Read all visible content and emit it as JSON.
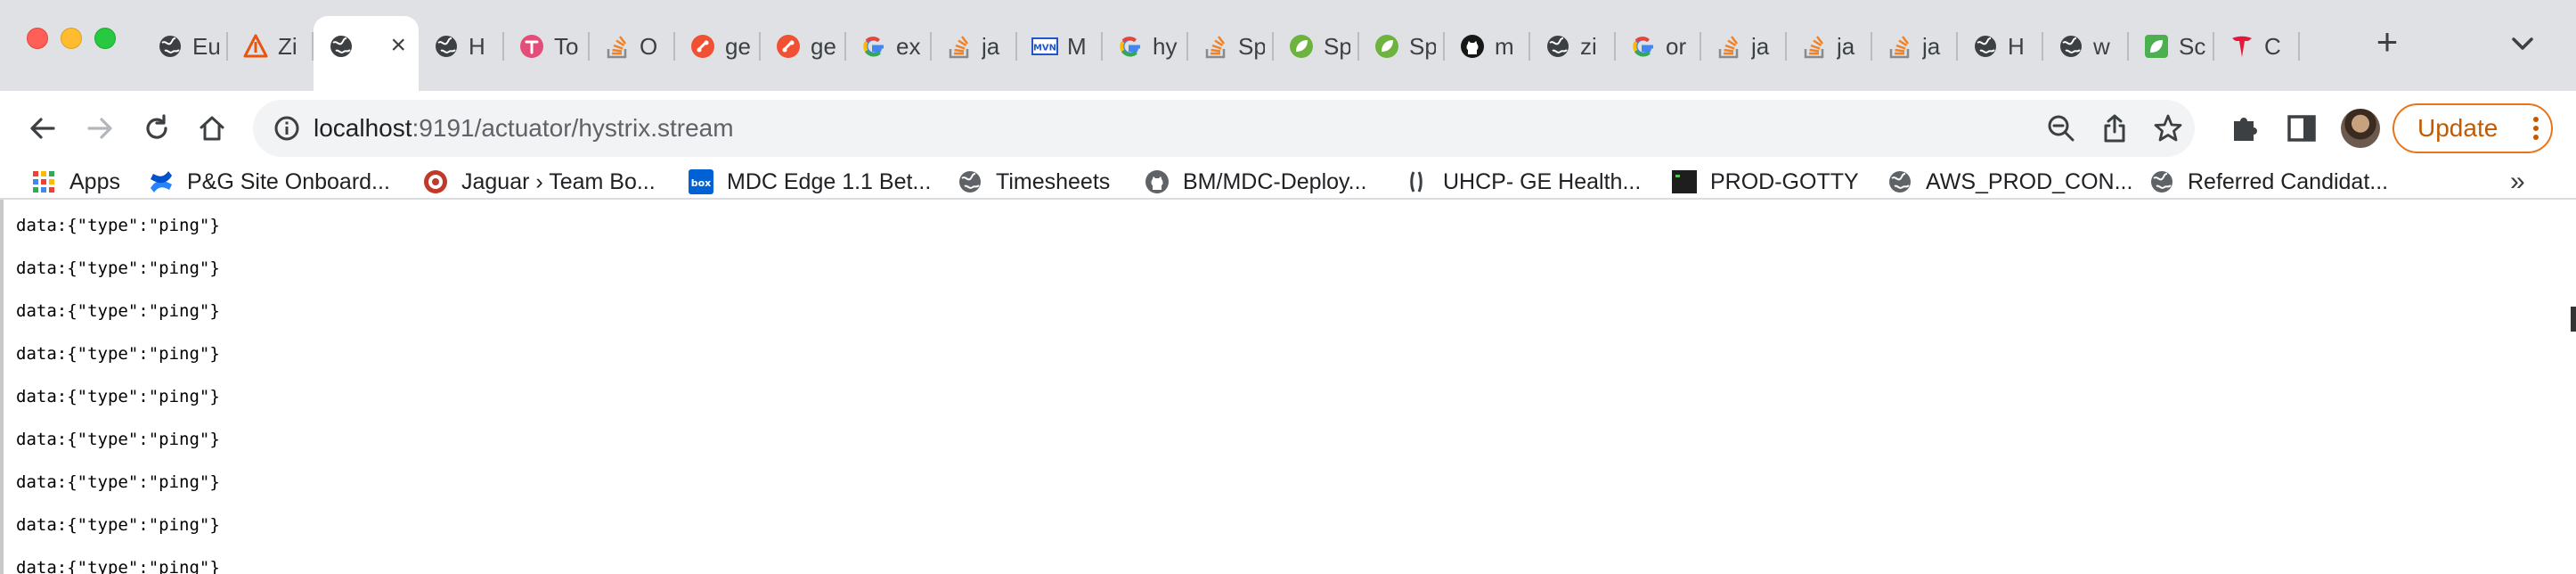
{
  "browser": {
    "tabs": [
      {
        "title": "Eu",
        "icon": "globe-icon",
        "color": "#3c4043"
      },
      {
        "title": "Zi",
        "icon": "zipkin-icon",
        "color": "#e8560e"
      },
      {
        "title": "",
        "icon": "globe-icon",
        "color": "#3c4043",
        "active": true
      },
      {
        "title": "H",
        "icon": "globe-icon",
        "color": "#3c4043"
      },
      {
        "title": "To",
        "icon": "todoist-icon",
        "color": "#e44c7a"
      },
      {
        "title": "O",
        "icon": "stackoverflow-icon",
        "color": "#f48024"
      },
      {
        "title": "ge",
        "icon": "git-icon",
        "color": "#f05133"
      },
      {
        "title": "ge",
        "icon": "git-icon",
        "color": "#f05133"
      },
      {
        "title": "ex",
        "icon": "google-icon",
        "color": "#4285f4"
      },
      {
        "title": "ja",
        "icon": "stackoverflow-icon",
        "color": "#f48024"
      },
      {
        "title": "M",
        "icon": "mvn-icon",
        "color": "#1f57c9"
      },
      {
        "title": "hy",
        "icon": "google-icon",
        "color": "#4285f4"
      },
      {
        "title": "Sp",
        "icon": "stackoverflow-icon",
        "color": "#f48024"
      },
      {
        "title": "Sp",
        "icon": "spring-icon",
        "color": "#6db33f"
      },
      {
        "title": "Sp",
        "icon": "spring-icon",
        "color": "#6db33f"
      },
      {
        "title": "m",
        "icon": "github-icon",
        "color": "#181717"
      },
      {
        "title": "zi",
        "icon": "globe-icon",
        "color": "#3c4043"
      },
      {
        "title": "or",
        "icon": "google-icon",
        "color": "#4285f4"
      },
      {
        "title": "ja",
        "icon": "stackoverflow-icon",
        "color": "#f48024"
      },
      {
        "title": "ja",
        "icon": "stackoverflow-icon",
        "color": "#f48024"
      },
      {
        "title": "ja",
        "icon": "stackoverflow-icon",
        "color": "#f48024"
      },
      {
        "title": "H",
        "icon": "globe-icon",
        "color": "#3c4043"
      },
      {
        "title": "w",
        "icon": "globe-icon",
        "color": "#3c4043"
      },
      {
        "title": "Sc",
        "icon": "leaf-icon",
        "color": "#4caf50"
      },
      {
        "title": "C",
        "icon": "tesla-icon",
        "color": "#e31937"
      }
    ],
    "new_tab_label": "+",
    "close_label": "×"
  },
  "toolbar": {
    "url_host": "localhost",
    "url_path": ":9191/actuator/hystrix.stream",
    "update_label": "Update"
  },
  "bookmarks": [
    {
      "label": "Apps",
      "icon": "apps-grid-icon"
    },
    {
      "label": "P&G Site Onboard...",
      "icon": "confluence-icon"
    },
    {
      "label": "Jaguar › Team Bo...",
      "icon": "jaguar-icon"
    },
    {
      "label": "MDC Edge 1.1 Bet...",
      "icon": "box-icon"
    },
    {
      "label": "Timesheets",
      "icon": "globe-icon"
    },
    {
      "label": "BM/MDC-Deploy...",
      "icon": "github-icon"
    },
    {
      "label": "UHCP- GE Health...",
      "icon": "ge-icon"
    },
    {
      "label": "PROD-GOTTY",
      "icon": "terminal-icon"
    },
    {
      "label": "AWS_PROD_CON...",
      "icon": "globe-icon"
    },
    {
      "label": "Referred Candidat...",
      "icon": "globe-icon"
    }
  ],
  "bookmarks_more": "»",
  "content": {
    "lines": [
      "data:{\"type\":\"ping\"}",
      "data:{\"type\":\"ping\"}",
      "data:{\"type\":\"ping\"}",
      "data:{\"type\":\"ping\"}",
      "data:{\"type\":\"ping\"}",
      "data:{\"type\":\"ping\"}",
      "data:{\"type\":\"ping\"}",
      "data:{\"type\":\"ping\"}",
      "data:{\"type\":\"ping\"}"
    ]
  }
}
